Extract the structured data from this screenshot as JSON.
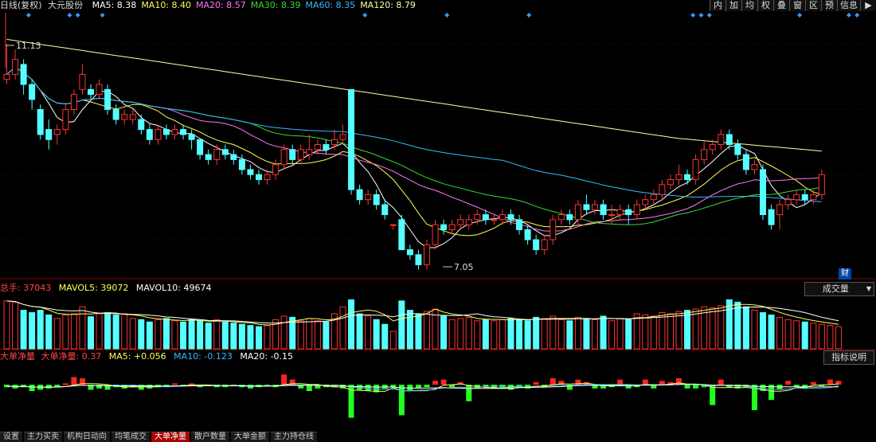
{
  "header": {
    "title": "日线(复权)",
    "stock": "大元股份",
    "ma": [
      {
        "label": "MA5:",
        "value": "8.38",
        "color": "#ffffff"
      },
      {
        "label": "MA10:",
        "value": "8.40",
        "color": "#ffff55"
      },
      {
        "label": "MA20:",
        "value": "8.57",
        "color": "#ff77ff"
      },
      {
        "label": "MA30:",
        "value": "8.39",
        "color": "#33dd33"
      },
      {
        "label": "MA60:",
        "value": "8.35",
        "color": "#33bbff"
      },
      {
        "label": "MA120:",
        "value": "8.79",
        "color": "#ffffaa"
      }
    ]
  },
  "toolbar": [
    "内",
    "加",
    "均",
    "权",
    "叠",
    "窗",
    "区",
    "预",
    "信息"
  ],
  "toolbar_arrow": "▶",
  "price": {
    "high_label": "11.13",
    "low_label": "7.05",
    "fin_label": "财",
    "high": 11.13,
    "low": 7.05
  },
  "volume_header": {
    "total_label": "总手:",
    "total": "37043",
    "mavol5_label": "MAVOL5:",
    "mavol5": "39072",
    "mavol10_label": "MAVOL10:",
    "mavol10": "49674",
    "selector": "成交量"
  },
  "net_header": {
    "name": "大单净量",
    "sub": "大单净量:",
    "value": "0.37",
    "ma5_label": "MA5:",
    "ma5": "+0.056",
    "ma10_label": "MA10:",
    "ma10": "-0.123",
    "ma20_label": "MA20:",
    "ma20": "-0.15",
    "help": "指标说明"
  },
  "tabs": [
    "设置",
    "主力买卖",
    "机构日动向",
    "均笔成交",
    "大单净量",
    "散户数量",
    "大单金额",
    "主力持仓线"
  ],
  "active_tab": 4,
  "colors": {
    "up": "#ff3333",
    "down": "#55ffff",
    "net_up": "#ff2222",
    "net_down": "#22ff22"
  },
  "chart_data": {
    "type": "candlestick",
    "candles": [
      [
        10.2,
        10.3,
        10.9,
        10.1
      ],
      [
        10.3,
        10.6,
        10.8,
        10.2
      ],
      [
        10.5,
        10.1,
        10.6,
        9.9
      ],
      [
        10.1,
        9.8,
        10.2,
        9.6
      ],
      [
        9.6,
        9.1,
        9.7,
        9.0
      ],
      [
        9.2,
        9.0,
        9.4,
        8.8
      ],
      [
        9.1,
        9.2,
        9.3,
        8.9
      ],
      [
        9.2,
        9.6,
        9.7,
        9.1
      ],
      [
        9.6,
        9.9,
        10.0,
        9.5
      ],
      [
        10.0,
        10.3,
        10.5,
        9.9
      ],
      [
        10.0,
        9.9,
        10.1,
        9.8
      ],
      [
        9.9,
        10.1,
        10.2,
        9.8
      ],
      [
        10.0,
        9.6,
        10.1,
        9.5
      ],
      [
        9.6,
        9.4,
        9.7,
        9.3
      ],
      [
        9.4,
        9.5,
        9.6,
        9.3
      ],
      [
        9.4,
        9.5,
        9.6,
        9.3
      ],
      [
        9.4,
        9.2,
        9.5,
        9.1
      ],
      [
        9.2,
        9.0,
        9.3,
        8.9
      ],
      [
        9.0,
        9.2,
        9.3,
        8.9
      ],
      [
        9.2,
        9.1,
        9.3,
        9.0
      ],
      [
        9.1,
        9.2,
        9.3,
        9.0
      ],
      [
        9.2,
        9.1,
        9.3,
        9.0
      ],
      [
        9.1,
        9.0,
        9.2,
        8.8
      ],
      [
        9.0,
        8.7,
        9.0,
        8.6
      ],
      [
        8.7,
        8.6,
        8.8,
        8.5
      ],
      [
        8.6,
        8.8,
        8.9,
        8.5
      ],
      [
        8.8,
        8.7,
        8.9,
        8.6
      ],
      [
        8.7,
        8.6,
        8.8,
        8.5
      ],
      [
        8.6,
        8.4,
        8.7,
        8.3
      ],
      [
        8.4,
        8.3,
        8.5,
        8.2
      ],
      [
        8.3,
        8.2,
        8.4,
        8.1
      ],
      [
        8.2,
        8.3,
        8.4,
        8.1
      ],
      [
        8.3,
        8.5,
        8.6,
        8.2
      ],
      [
        8.5,
        8.8,
        8.9,
        8.4
      ],
      [
        8.8,
        8.6,
        8.9,
        8.5
      ],
      [
        8.6,
        8.8,
        8.9,
        8.5
      ],
      [
        8.7,
        8.8,
        9.1,
        8.6
      ],
      [
        8.8,
        8.9,
        9.0,
        8.7
      ],
      [
        8.9,
        8.8,
        9.0,
        8.7
      ],
      [
        8.9,
        9.0,
        9.2,
        8.8
      ],
      [
        9.0,
        9.1,
        9.3,
        8.9
      ],
      [
        10.0,
        8.0,
        10.0,
        7.9
      ],
      [
        8.0,
        7.8,
        8.1,
        7.7
      ],
      [
        7.8,
        7.9,
        8.0,
        7.7
      ],
      [
        7.9,
        7.7,
        8.0,
        7.6
      ],
      [
        7.7,
        7.5,
        7.8,
        7.4
      ],
      [
        7.3,
        7.3,
        7.3,
        7.2
      ],
      [
        7.4,
        6.8,
        7.5,
        6.8
      ],
      [
        6.8,
        6.7,
        6.9,
        6.6
      ],
      [
        6.7,
        6.5,
        6.8,
        6.4
      ],
      [
        6.5,
        6.9,
        7.0,
        6.4
      ],
      [
        6.9,
        7.3,
        7.4,
        6.8
      ],
      [
        7.3,
        7.2,
        7.4,
        7.1
      ],
      [
        7.2,
        7.3,
        7.4,
        7.1
      ],
      [
        7.3,
        7.4,
        7.5,
        7.2
      ],
      [
        7.3,
        7.4,
        7.5,
        7.2
      ],
      [
        7.4,
        7.5,
        7.6,
        7.3
      ],
      [
        7.5,
        7.4,
        7.6,
        7.3
      ],
      [
        7.4,
        7.4,
        7.5,
        7.3
      ],
      [
        7.4,
        7.5,
        7.6,
        7.3
      ],
      [
        7.5,
        7.4,
        7.6,
        7.3
      ],
      [
        7.4,
        7.2,
        7.5,
        7.1
      ],
      [
        7.2,
        7.0,
        7.3,
        6.9
      ],
      [
        7.0,
        6.8,
        7.1,
        6.7
      ],
      [
        6.8,
        7.0,
        7.1,
        6.7
      ],
      [
        7.0,
        7.4,
        7.5,
        6.9
      ],
      [
        7.4,
        7.5,
        7.6,
        7.3
      ],
      [
        7.5,
        7.4,
        7.6,
        7.3
      ],
      [
        7.4,
        7.7,
        7.8,
        7.3
      ],
      [
        7.7,
        7.6,
        7.9,
        7.5
      ],
      [
        7.6,
        7.7,
        7.8,
        7.5
      ],
      [
        7.7,
        7.5,
        7.8,
        7.4
      ],
      [
        7.5,
        7.5,
        7.7,
        7.3
      ],
      [
        7.5,
        7.6,
        7.7,
        7.4
      ],
      [
        7.6,
        7.5,
        7.7,
        7.3
      ],
      [
        7.5,
        7.7,
        7.8,
        7.4
      ],
      [
        7.7,
        7.8,
        7.9,
        7.6
      ],
      [
        7.8,
        7.9,
        8.0,
        7.7
      ],
      [
        7.9,
        8.1,
        8.2,
        7.8
      ],
      [
        8.1,
        8.2,
        8.3,
        8.0
      ],
      [
        8.2,
        8.3,
        8.5,
        8.1
      ],
      [
        8.3,
        8.2,
        8.4,
        8.1
      ],
      [
        8.2,
        8.6,
        8.7,
        8.1
      ],
      [
        8.6,
        8.8,
        9.0,
        8.5
      ],
      [
        8.8,
        8.9,
        9.0,
        8.7
      ],
      [
        8.9,
        9.1,
        9.2,
        8.8
      ],
      [
        9.1,
        8.9,
        9.2,
        8.8
      ],
      [
        8.9,
        8.7,
        9.0,
        8.6
      ],
      [
        8.7,
        8.4,
        8.8,
        8.3
      ],
      [
        8.4,
        8.5,
        8.6,
        8.3
      ],
      [
        8.4,
        7.5,
        8.5,
        7.4
      ],
      [
        7.6,
        7.3,
        7.7,
        7.2
      ],
      [
        7.5,
        7.7,
        7.8,
        7.2
      ],
      [
        7.7,
        7.8,
        7.9,
        7.6
      ],
      [
        7.8,
        7.9,
        8.0,
        7.7
      ],
      [
        7.9,
        7.8,
        8.0,
        7.7
      ],
      [
        7.8,
        7.9,
        8.0,
        7.7
      ],
      [
        7.9,
        8.3,
        8.4,
        7.8
      ]
    ],
    "volume": [
      82,
      80,
      66,
      62,
      66,
      58,
      52,
      58,
      60,
      72,
      55,
      60,
      62,
      58,
      60,
      52,
      50,
      46,
      50,
      52,
      48,
      46,
      50,
      48,
      44,
      50,
      46,
      44,
      42,
      40,
      38,
      40,
      50,
      56,
      54,
      48,
      52,
      48,
      46,
      60,
      72,
      84,
      60,
      56,
      50,
      42,
      30,
      82,
      66,
      60,
      64,
      68,
      56,
      50,
      52,
      54,
      48,
      50,
      48,
      50,
      52,
      50,
      48,
      54,
      52,
      56,
      50,
      48,
      54,
      52,
      50,
      56,
      48,
      52,
      50,
      60,
      58,
      56,
      62,
      60,
      64,
      66,
      68,
      72,
      70,
      74,
      84,
      80,
      72,
      66,
      62,
      58,
      54,
      50,
      48,
      46,
      44,
      42,
      40,
      38
    ],
    "net": [
      -0.2,
      -0.3,
      -0.2,
      -0.5,
      -0.4,
      -0.3,
      -0.2,
      0.1,
      0.6,
      0.5,
      -0.4,
      -0.3,
      -0.4,
      -0.2,
      -0.3,
      -0.2,
      -0.4,
      -0.3,
      -0.2,
      -0.1,
      0.1,
      -0.1,
      0.1,
      -0.2,
      -0.1,
      -0.2,
      -0.2,
      -0.1,
      -0.2,
      -0.3,
      -0.2,
      -0.1,
      -0.2,
      0.8,
      0.4,
      -0.3,
      -0.5,
      -0.3,
      -0.2,
      -0.2,
      -0.3,
      -2.6,
      -0.4,
      -0.5,
      -0.6,
      -0.3,
      -0.2,
      -2.4,
      -0.5,
      -0.3,
      -0.2,
      0.3,
      0.4,
      -0.2,
      0.2,
      -1.3,
      -0.3,
      -0.2,
      -0.3,
      -0.3,
      -0.4,
      -0.2,
      -0.3,
      0.2,
      -0.2,
      0.5,
      0.3,
      -0.4,
      0.4,
      0.2,
      -0.3,
      -0.3,
      -0.2,
      0.4,
      -0.3,
      -0.2,
      0.4,
      -0.3,
      0.3,
      0.2,
      0.5,
      -0.3,
      -0.3,
      -0.2,
      -1.6,
      0.4,
      -0.2,
      -0.3,
      -0.2,
      -2.0,
      -0.5,
      -1.2,
      -0.4,
      0.3,
      -0.2,
      -0.3,
      0.2,
      -0.1,
      0.4,
      0.3
    ]
  }
}
